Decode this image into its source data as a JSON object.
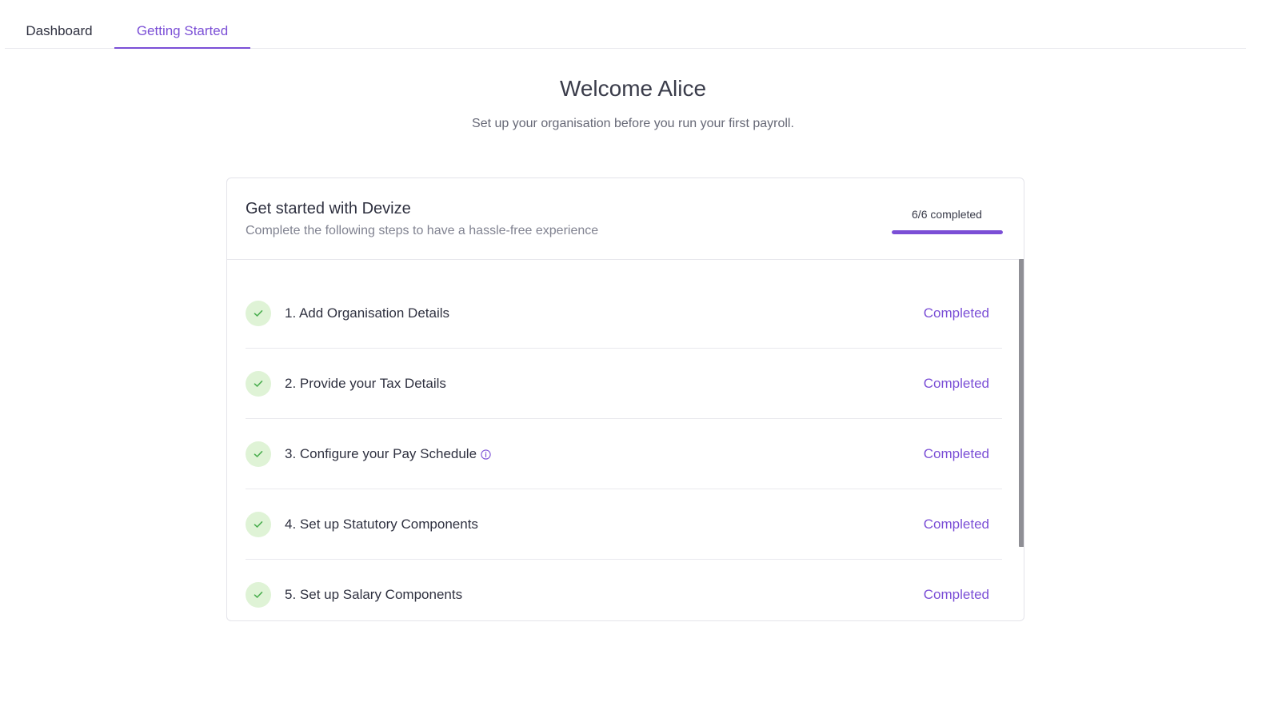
{
  "tabs": [
    {
      "label": "Dashboard",
      "active": false
    },
    {
      "label": "Getting Started",
      "active": true
    }
  ],
  "header": {
    "title": "Welcome Alice",
    "subtitle": "Set up your organisation before you run your first payroll."
  },
  "card": {
    "title": "Get started with Devize",
    "description": "Complete the following steps to have a hassle-free experience",
    "progress_label": "6/6 completed",
    "progress_fraction": 1.0
  },
  "steps": [
    {
      "label": "1. Add Organisation Details",
      "status": "Completed"
    },
    {
      "label": "2. Provide your Tax Details",
      "status": "Completed"
    },
    {
      "label": "3. Configure your Pay Schedule",
      "status": "Completed",
      "info_icon": "info-circle-icon"
    },
    {
      "label": "4. Set up Statutory Components",
      "status": "Completed"
    },
    {
      "label": "5. Set up Salary Components",
      "status": "Completed"
    }
  ],
  "colors": {
    "accent": "#7b4fd6",
    "check_bg": "#dff3d6",
    "check_mark": "#4caf50"
  }
}
